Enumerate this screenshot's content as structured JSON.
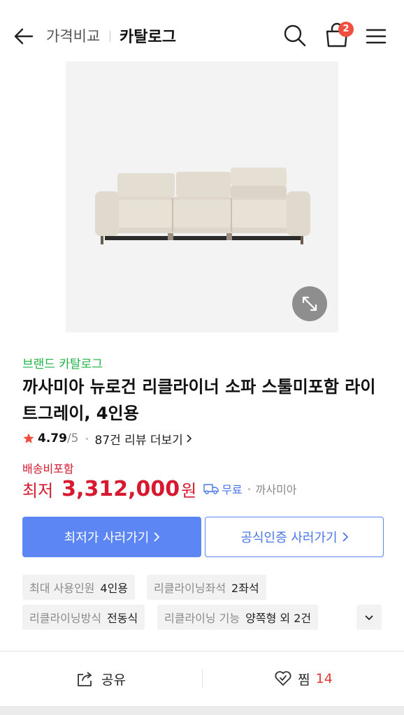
{
  "header": {
    "crumb_compare": "가격비교",
    "crumb_catalog": "카탈로그",
    "cart_count": "2",
    "icons": [
      "back-arrow-icon",
      "search-icon",
      "shopping-bag-icon",
      "hamburger-menu-icon"
    ]
  },
  "product": {
    "image_alt": "light gray reclining sofa",
    "brand_label": "브랜드 카탈로그",
    "title": "까사미아 뉴로건 리클라이너 소파 스툴미포함 라이트그레이, 4인용",
    "rating": "4.79",
    "rating_max": "/5",
    "review_link": "87건 리뷰 더보기"
  },
  "pricing": {
    "shipping_note": "배송비포함",
    "price_label": "최저",
    "price_value": "3,312,000",
    "price_unit": "원",
    "shipping_tag": "무료",
    "seller": "까사미아"
  },
  "actions": {
    "lowest_button": "최저가 사러가기",
    "official_button": "공식인증 사러가기"
  },
  "specs": [
    {
      "label": "최대 사용인원",
      "value": "4인용"
    },
    {
      "label": "리클라이닝좌석",
      "value": "2좌석"
    },
    {
      "label": "리클라이닝방식",
      "value": "전동식"
    },
    {
      "label": "리클라이닝 기능",
      "value": "양쪽형 외 2건"
    }
  ],
  "bottom_bar": {
    "share_label": "공유",
    "wish_label": "찜",
    "wish_count": "14"
  },
  "colors": {
    "brand_green": "#1fb344",
    "price_red": "#d6192f",
    "accent_blue": "#5c86f4",
    "badge_red": "#f04e3e"
  }
}
